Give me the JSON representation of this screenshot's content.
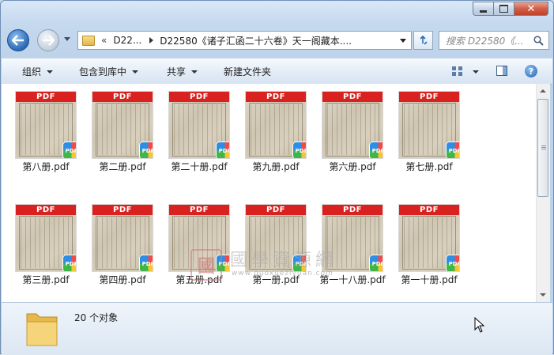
{
  "window": {
    "caption_buttons": [
      "minimize",
      "maximize",
      "close"
    ],
    "close_glyph": "✕"
  },
  "nav": {
    "back_icon": "back-arrow-icon",
    "forward_icon": "forward-arrow-icon"
  },
  "address": {
    "chevron": "«",
    "segment_1": "D22...",
    "segment_2": "D22580《诸子汇函二十六卷》天一阁藏本...."
  },
  "search": {
    "placeholder": "搜索 D22580《..."
  },
  "toolbar": {
    "organize": "组织",
    "include_in_library": "包含到库中",
    "share": "共享",
    "new_folder": "新建文件夹",
    "help": "?"
  },
  "files": [
    {
      "name": "第八册.pdf",
      "band": "PDF",
      "badge": "PDF"
    },
    {
      "name": "第二册.pdf",
      "band": "PDF",
      "badge": "PDF"
    },
    {
      "name": "第二十册.pdf",
      "band": "PDF",
      "badge": "PDF"
    },
    {
      "name": "第九册.pdf",
      "band": "PDF",
      "badge": "PDF"
    },
    {
      "name": "第六册.pdf",
      "band": "PDF",
      "badge": "PDF"
    },
    {
      "name": "第七册.pdf",
      "band": "PDF",
      "badge": "PDF"
    },
    {
      "name": "第三册.pdf",
      "band": "PDF",
      "badge": "PDF"
    },
    {
      "name": "第四册.pdf",
      "band": "PDF",
      "badge": "PDF"
    },
    {
      "name": "第五册.pdf",
      "band": "PDF",
      "badge": "PDF"
    },
    {
      "name": "第一册.pdf",
      "band": "PDF",
      "badge": "PDF"
    },
    {
      "name": "第一十八册.pdf",
      "band": "PDF",
      "badge": "PDF"
    },
    {
      "name": "第一十册.pdf",
      "band": "PDF",
      "badge": "PDF"
    }
  ],
  "watermark": {
    "seal": "國",
    "title": "國學資源網",
    "url": "www.guoxueziyuan.com"
  },
  "details": {
    "count_text": "20 个对象"
  },
  "colors": {
    "pdf_band": "#d9221f",
    "window_frame": "#bed3ea",
    "close_button": "#d25f47"
  }
}
